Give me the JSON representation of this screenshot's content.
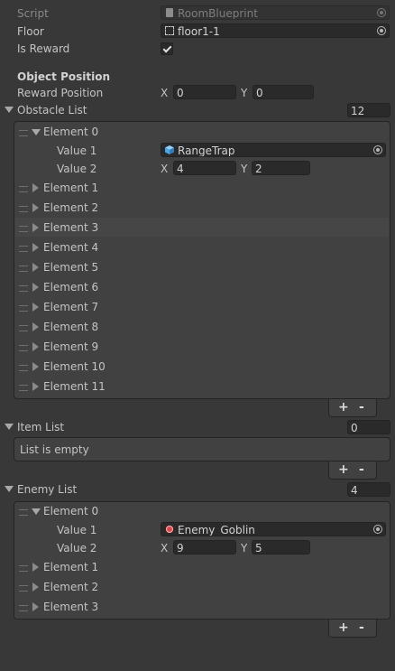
{
  "script": {
    "label": "Script",
    "value": "RoomBlueprint"
  },
  "floor": {
    "label": "Floor",
    "value": "floor1-1"
  },
  "is_reward": {
    "label": "Is Reward",
    "checked": true
  },
  "object_position": {
    "header": "Object Position",
    "reward_position": {
      "label": "Reward Position",
      "x_label": "X",
      "y_label": "Y",
      "x": "0",
      "y": "0"
    }
  },
  "obstacle_list": {
    "label": "Obstacle List",
    "count": "12",
    "element0": {
      "label": "Element 0",
      "value1_label": "Value 1",
      "value1": "RangeTrap",
      "value2_label": "Value 2",
      "x_label": "X",
      "y_label": "Y",
      "x": "4",
      "y": "2"
    },
    "collapsed": [
      "Element 1",
      "Element 2",
      "Element 3",
      "Element 4",
      "Element 5",
      "Element 6",
      "Element 7",
      "Element 8",
      "Element 9",
      "Element 10",
      "Element 11"
    ]
  },
  "item_list": {
    "label": "Item List",
    "count": "0",
    "empty_text": "List is empty"
  },
  "enemy_list": {
    "label": "Enemy List",
    "count": "4",
    "element0": {
      "label": "Element 0",
      "value1_label": "Value 1",
      "value1": "Enemy_Goblin",
      "value2_label": "Value 2",
      "x_label": "X",
      "y_label": "Y",
      "x": "9",
      "y": "5"
    },
    "collapsed": [
      "Element 1",
      "Element 2",
      "Element 3"
    ]
  },
  "footer": {
    "add": "+",
    "remove": "-"
  },
  "colors": {
    "background": "#383838",
    "list_background": "#414141",
    "field_background": "#2a2a2a",
    "text": "#c4c4c4",
    "trap_icon": "#4aa7e8",
    "enemy_icon": "#e04545"
  },
  "icons": {
    "script": "script-asset-icon",
    "floor": "scene-asset-icon",
    "trap": "cube-icon",
    "enemy": "red-dot-icon",
    "picker": "object-picker-icon"
  }
}
